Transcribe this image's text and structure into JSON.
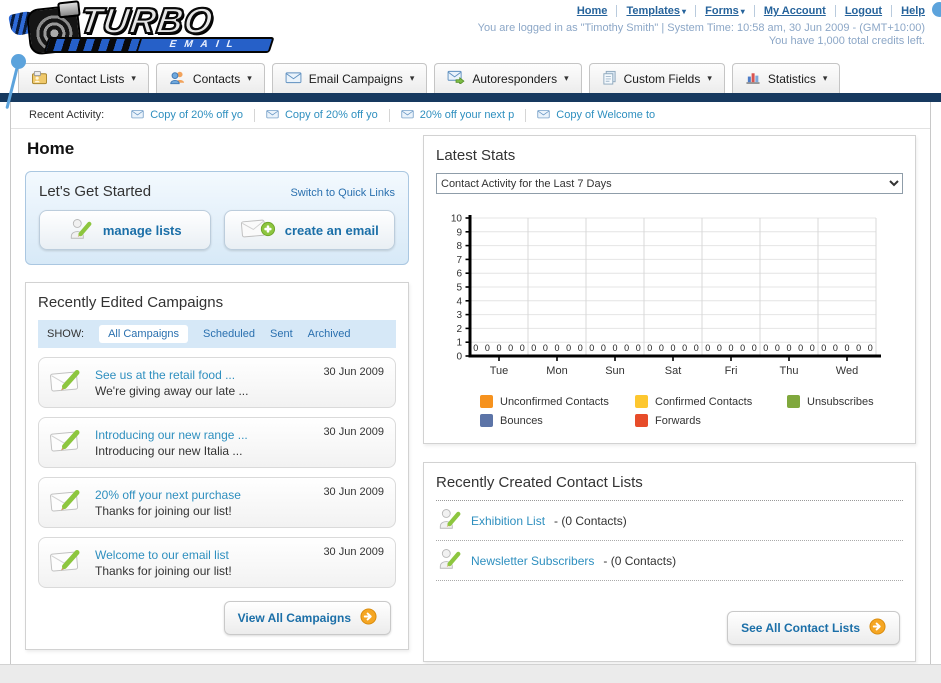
{
  "page": {
    "title": "Home"
  },
  "header": {
    "logo_line1": "TURBO",
    "logo_line2": "EMAIL",
    "nav": [
      {
        "label": "Home"
      },
      {
        "label": "Templates",
        "arrow": "▾"
      },
      {
        "label": "Forms",
        "arrow": "▾"
      },
      {
        "label": "My Account"
      },
      {
        "label": "Logout"
      },
      {
        "label": "Help"
      }
    ],
    "login_info": "You are logged in as \"Timothy Smith\" | System Time: 10:58 am, 30 Jun 2009 - (GMT+10:00)",
    "credits_info": "You have 1,000 total credits left."
  },
  "tabs": [
    {
      "label": "Contact Lists",
      "arrow": "▾"
    },
    {
      "label": "Contacts",
      "arrow": "▾"
    },
    {
      "label": "Email Campaigns",
      "arrow": "▾"
    },
    {
      "label": "Autoresponders",
      "arrow": "▾"
    },
    {
      "label": "Custom Fields",
      "arrow": "▾"
    },
    {
      "label": "Statistics",
      "arrow": "▾"
    }
  ],
  "recent_activity": {
    "label": "Recent Activity:",
    "items": [
      "Copy of 20% off yo",
      "Copy of 20% off yo",
      "20% off your next p",
      "Copy of Welcome to"
    ]
  },
  "get_started": {
    "title": "Let's Get Started",
    "switch_link": "Switch to Quick Links",
    "manage_lists_label": "manage lists",
    "create_email_label": "create an email"
  },
  "campaigns": {
    "title": "Recently Edited Campaigns",
    "show_label": "SHOW:",
    "filters": [
      "All Campaigns",
      "Scheduled",
      "Sent",
      "Archived"
    ],
    "items": [
      {
        "title": "See us at the retail food ...",
        "subtitle": "We're giving away our late ...",
        "date": "30 Jun 2009"
      },
      {
        "title": "Introducing our new range ...",
        "subtitle": "Introducing our new Italia ...",
        "date": "30 Jun 2009"
      },
      {
        "title": "20% off your next purchase",
        "subtitle": "Thanks for joining our list!",
        "date": "30 Jun 2009"
      },
      {
        "title": "Welcome to our email list",
        "subtitle": "Thanks for joining our list!",
        "date": "30 Jun 2009"
      }
    ],
    "view_all_label": "View All Campaigns"
  },
  "stats": {
    "title": "Latest Stats",
    "dropdown_value": "Contact Activity for the Last 7 Days"
  },
  "chart_data": {
    "type": "bar",
    "title": "Contact Activity for the Last 7 Days",
    "categories": [
      "Tue",
      "Mon",
      "Sun",
      "Sat",
      "Fri",
      "Thu",
      "Wed"
    ],
    "series": [
      {
        "name": "Unconfirmed Contacts",
        "color": "#F6921E",
        "values": [
          0,
          0,
          0,
          0,
          0,
          0,
          0
        ]
      },
      {
        "name": "Confirmed Contacts",
        "color": "#FDC72F",
        "values": [
          0,
          0,
          0,
          0,
          0,
          0,
          0
        ]
      },
      {
        "name": "Unsubscribes",
        "color": "#80A83D",
        "values": [
          0,
          0,
          0,
          0,
          0,
          0,
          0
        ]
      },
      {
        "name": "Bounces",
        "color": "#5C74A7",
        "values": [
          0,
          0,
          0,
          0,
          0,
          0,
          0
        ]
      },
      {
        "name": "Forwards",
        "color": "#E74C2A",
        "values": [
          0,
          0,
          0,
          0,
          0,
          0,
          0
        ]
      }
    ],
    "ylim": [
      0,
      10
    ],
    "ytick_step": 1,
    "grid": true,
    "legend_position": "bottom"
  },
  "contact_lists": {
    "title": "Recently Created Contact Lists",
    "items": [
      {
        "name": "Exhibition List",
        "suffix": " - (0 Contacts)"
      },
      {
        "name": "Newsletter Subscribers",
        "suffix": " - (0 Contacts)"
      }
    ],
    "see_all_label": "See All Contact Lists"
  }
}
